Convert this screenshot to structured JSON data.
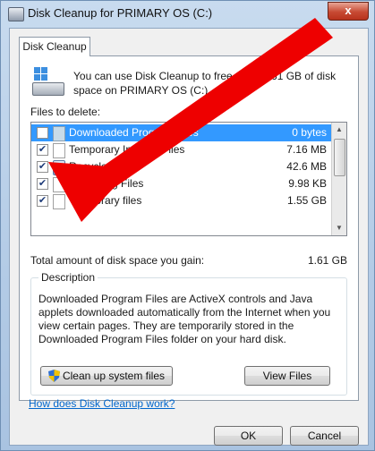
{
  "window": {
    "title": "Disk Cleanup for PRIMARY OS (C:)",
    "close_label": "x"
  },
  "tab": {
    "label": "Disk Cleanup"
  },
  "intro": "You can use Disk Cleanup to free up to 1.61 GB of disk space on PRIMARY OS (C:).",
  "files_to_delete_label": "Files to delete:",
  "files": [
    {
      "name": "Downloaded Program Files",
      "size": "0 bytes",
      "checked": false,
      "selected": true,
      "icon": "folder-icon"
    },
    {
      "name": "Temporary Internet Files",
      "size": "7.16 MB",
      "checked": true,
      "selected": false,
      "icon": "lock-file-icon"
    },
    {
      "name": "Recycle Bin",
      "size": "42.6 MB",
      "checked": true,
      "selected": false,
      "icon": "recycle-bin-icon"
    },
    {
      "name": "Setup Log Files",
      "size": "9.98 KB",
      "checked": true,
      "selected": false,
      "icon": "file-icon"
    },
    {
      "name": "Temporary files",
      "size": "1.55 GB",
      "checked": true,
      "selected": false,
      "icon": "file-icon"
    }
  ],
  "total_label": "Total amount of disk space you gain:",
  "total_value": "1.61 GB",
  "description": {
    "legend": "Description",
    "text": "Downloaded Program Files are ActiveX controls and Java applets downloaded automatically from the Internet when you view certain pages. They are temporarily stored in the Downloaded Program Files folder on your hard disk."
  },
  "buttons": {
    "cleanup_system": "Clean up system files",
    "view_files": "View Files",
    "ok": "OK",
    "cancel": "Cancel"
  },
  "help_link": "How does Disk Cleanup work?",
  "colors": {
    "annotation_arrow": "#ee0000",
    "selection": "#3399ff",
    "link": "#0066cc"
  }
}
